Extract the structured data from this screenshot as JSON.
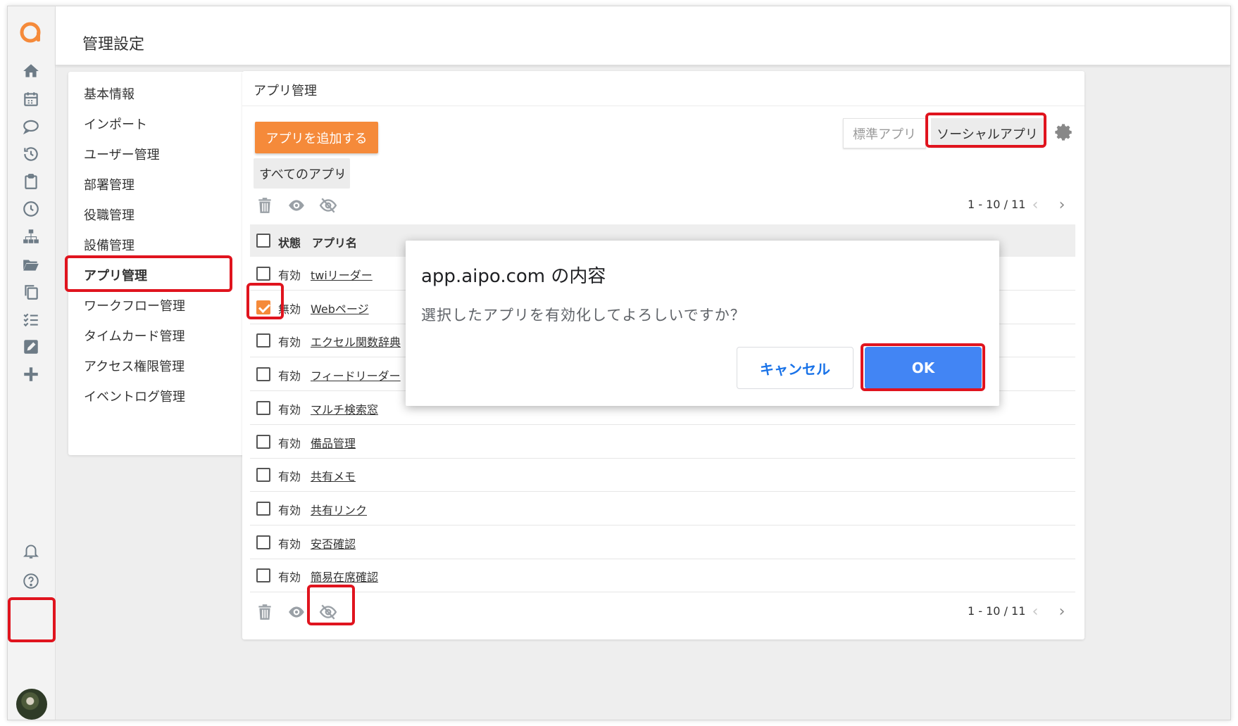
{
  "header": {
    "title": "管理設定"
  },
  "rail": {
    "logo": "aipo-logo",
    "icons": [
      "home-icon",
      "calendar-icon",
      "chat-icon",
      "history-icon",
      "clipboard-icon",
      "clock-icon",
      "org-chart-icon",
      "folder-icon",
      "copy-icon",
      "checklist-icon",
      "edit-icon",
      "plus-icon"
    ],
    "bottom_icons": [
      "bell-icon",
      "help-icon"
    ],
    "avatar": "user-avatar"
  },
  "sidebar": {
    "items": [
      {
        "label": "基本情報"
      },
      {
        "label": "インポート"
      },
      {
        "label": "ユーザー管理"
      },
      {
        "label": "部署管理"
      },
      {
        "label": "役職管理"
      },
      {
        "label": "設備管理"
      },
      {
        "label": "アプリ管理",
        "active": true
      },
      {
        "label": "ワークフロー管理"
      },
      {
        "label": "タイムカード管理"
      },
      {
        "label": "アクセス権限管理"
      },
      {
        "label": "イベントログ管理"
      }
    ]
  },
  "main": {
    "title": "アプリ管理",
    "add_button": "アプリを追加する",
    "filter": {
      "selected": "すべてのアプリ",
      "caret": "⌄"
    },
    "tabs": {
      "standard": "標準アプリ",
      "social": "ソーシャルアプリ"
    },
    "pager": {
      "text": "1 - 10 / 11",
      "prev": "‹",
      "next": "›"
    },
    "table": {
      "headers": {
        "status": "状態",
        "name": "アプリ名"
      },
      "rows": [
        {
          "status": "有効",
          "name": "twiリーダー",
          "checked": false
        },
        {
          "status": "無効",
          "name": "Webページ",
          "checked": true
        },
        {
          "status": "有効",
          "name": "エクセル関数辞典",
          "checked": false
        },
        {
          "status": "有効",
          "name": "フィードリーダー",
          "checked": false
        },
        {
          "status": "有効",
          "name": "マルチ検索窓",
          "checked": false
        },
        {
          "status": "有効",
          "name": "備品管理",
          "checked": false
        },
        {
          "status": "有効",
          "name": "共有メモ",
          "checked": false
        },
        {
          "status": "有効",
          "name": "共有リンク",
          "checked": false
        },
        {
          "status": "有効",
          "name": "安否確認",
          "checked": false
        },
        {
          "status": "有効",
          "name": "簡易在席確認",
          "checked": false
        }
      ]
    }
  },
  "dialog": {
    "title": "app.aipo.com の内容",
    "message": "選択したアプリを有効化してよろしいですか？",
    "cancel": "キャンセル",
    "ok": "OK"
  },
  "colors": {
    "accent": "#f58a3a",
    "highlight": "#e0141e",
    "ok_button": "#4285f4",
    "link_button": "#1a73e8"
  }
}
